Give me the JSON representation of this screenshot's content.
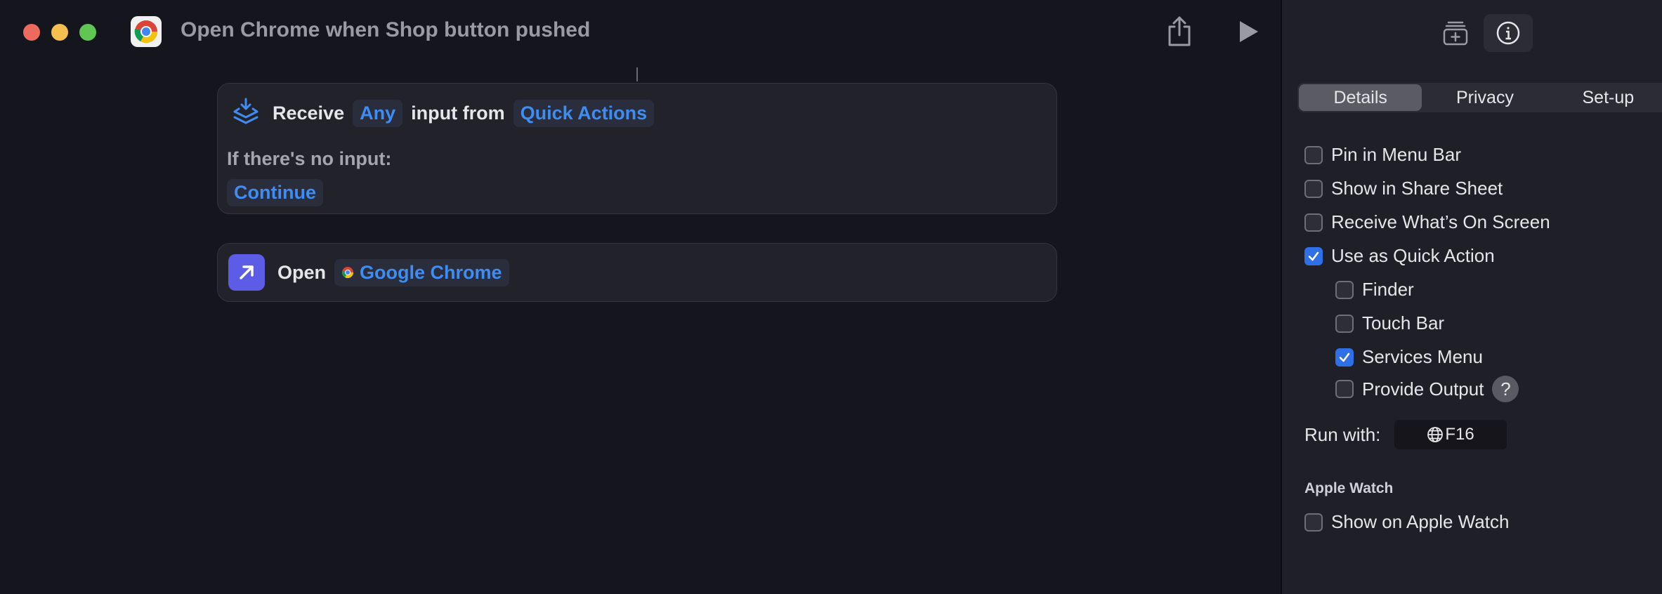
{
  "window": {
    "title": "Open Chrome when Shop button pushed",
    "icons": {
      "app": "chrome-icon",
      "share": "share-icon",
      "run": "play-icon"
    }
  },
  "actions": {
    "receive": {
      "verb": "Receive",
      "input_type": "Any",
      "middle": "input from",
      "source": "Quick Actions",
      "no_input_label": "If there's no input:",
      "no_input_action": "Continue"
    },
    "open": {
      "verb": "Open",
      "app": "Google Chrome"
    }
  },
  "sidebar": {
    "icons": {
      "library": "add-to-library-icon",
      "info": "info-icon"
    },
    "tabs": [
      {
        "label": "Details",
        "active": true
      },
      {
        "label": "Privacy",
        "active": false
      },
      {
        "label": "Set-up",
        "active": false
      }
    ],
    "options": [
      {
        "label": "Pin in Menu Bar",
        "checked": false
      },
      {
        "label": "Show in Share Sheet",
        "checked": false
      },
      {
        "label": "Receive What’s On Screen",
        "checked": false
      },
      {
        "label": "Use as Quick Action",
        "checked": true
      }
    ],
    "quick_action_options": [
      {
        "label": "Finder",
        "checked": false
      },
      {
        "label": "Touch Bar",
        "checked": false
      },
      {
        "label": "Services Menu",
        "checked": true
      },
      {
        "label": "Provide Output",
        "checked": false
      }
    ],
    "help_label": "?",
    "run_with": {
      "label": "Run with:",
      "value": "F16"
    },
    "apple_watch": {
      "title": "Apple Watch",
      "option": {
        "label": "Show on Apple Watch",
        "checked": false
      }
    }
  },
  "colors": {
    "accent": "#2f6fe8",
    "link": "#3f8cf2",
    "action_icon": "#5d5ce6"
  }
}
